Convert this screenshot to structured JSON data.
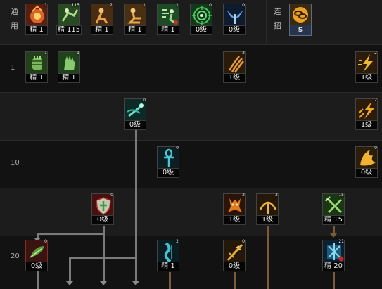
{
  "header": {
    "general_label_line1": "通",
    "general_label_line2": "用",
    "combo_label_line1": "连",
    "combo_label_line2": "招"
  },
  "levels": [
    "1",
    "10",
    "20"
  ],
  "general_skills": [
    {
      "icon": "flame-fist-icon",
      "level": "1",
      "badge": "精 1",
      "color": "#c0442a"
    },
    {
      "icon": "leaping-kick-icon",
      "level": "115",
      "badge": "精 115",
      "color": "#4e8a3e"
    },
    {
      "icon": "crouch-stance-icon",
      "level": "2",
      "badge": "精 1",
      "color": "#c2883a"
    },
    {
      "icon": "sitting-meditation-icon",
      "level": "1",
      "badge": "精 1",
      "color": "#c8953c"
    },
    {
      "icon": "escape-dash-icon",
      "level": "1",
      "badge": "精 1",
      "color": "#3f8a49"
    },
    {
      "icon": "target-lock-icon",
      "level": "0",
      "badge": "0级",
      "color": "#2f7a3a"
    },
    {
      "icon": "winged-buff-icon",
      "level": "0",
      "badge": "0级",
      "color": "#3b72b0"
    }
  ],
  "combo_skill": {
    "icon": "combo-chain-icon",
    "badge": "S"
  },
  "tree_skills": [
    {
      "id": "r1-a",
      "icon": "green-gauntlet-icon",
      "level": "1",
      "badge": "精 1",
      "color": "#4d8a3a"
    },
    {
      "id": "r1-b",
      "icon": "green-palm-icon",
      "level": "1",
      "badge": "精 1",
      "color": "#4f8f45"
    },
    {
      "id": "r1-c",
      "icon": "claw-slash-icon",
      "level": "2",
      "badge": "1级",
      "color": "#b2701f"
    },
    {
      "id": "r1-d",
      "icon": "lightning-strike-icon",
      "level": "2",
      "badge": "1级",
      "color": "#c8891a"
    },
    {
      "id": "r2-a",
      "icon": "spirit-kick-icon",
      "level": "0",
      "badge": "0级",
      "color": "#35a08c"
    },
    {
      "id": "r2-b",
      "icon": "energy-burst-icon",
      "level": "2",
      "badge": "1级",
      "color": "#c58a1a"
    },
    {
      "id": "r3-a",
      "icon": "ankh-icon",
      "level": "0",
      "badge": "0级",
      "color": "#2a8e9a"
    },
    {
      "id": "r3-b",
      "icon": "golden-wings-icon",
      "level": "0",
      "badge": "0级",
      "color": "#c8901e"
    },
    {
      "id": "r4-a",
      "icon": "shield-icon",
      "level": "0",
      "badge": "0级",
      "color": "#9a2a2a"
    },
    {
      "id": "r4-b",
      "icon": "demon-summon-icon",
      "level": "2",
      "badge": "1级",
      "color": "#b2681a"
    },
    {
      "id": "r4-c",
      "icon": "bow-arc-icon",
      "level": "2",
      "badge": "1级",
      "color": "#b27a1e"
    },
    {
      "id": "r4-d",
      "icon": "crossed-blades-icon",
      "level": "15",
      "badge": "精 15",
      "color": "#4d8a3e"
    },
    {
      "id": "r5-a",
      "icon": "leaf-boot-icon",
      "level": "0",
      "badge": "0级",
      "color": "#4a6a2a"
    },
    {
      "id": "r5-b",
      "icon": "water-pillar-icon",
      "level": "2",
      "badge": "精 1",
      "color": "#2a7c8e"
    },
    {
      "id": "r5-c",
      "icon": "rising-sword-icon",
      "level": "0",
      "badge": "0级",
      "color": "#a66e1e"
    },
    {
      "id": "r5-d",
      "icon": "frost-sigil-icon",
      "level": "21",
      "badge": "精 20",
      "color": "#2a6a8a"
    }
  ]
}
